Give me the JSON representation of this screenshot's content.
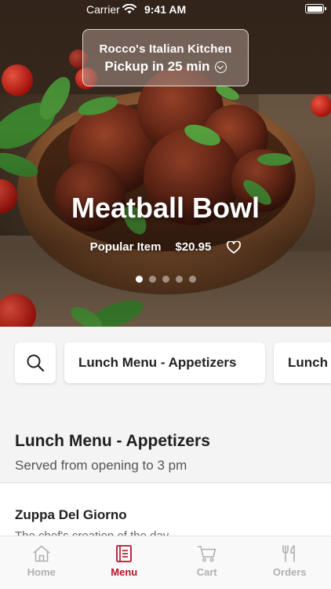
{
  "status_bar": {
    "carrier": "Carrier",
    "time": "9:41 AM"
  },
  "store": {
    "name": "Rocco's Italian Kitchen",
    "pickup": "Pickup in 25 min"
  },
  "featured": {
    "title": "Meatball Bowl",
    "tag": "Popular Item",
    "price": "$20.95",
    "slide_count": 5,
    "active_slide": 0
  },
  "categories": [
    "Lunch Menu - Appetizers",
    "Lunch"
  ],
  "section": {
    "title": "Lunch Menu - Appetizers",
    "subtitle": "Served from opening to 3 pm"
  },
  "items": [
    {
      "name": "Zuppa Del Giorno",
      "description": "The chef's creation of the day"
    }
  ],
  "tabs": [
    {
      "label": "Home",
      "icon": "home-icon",
      "active": false
    },
    {
      "label": "Menu",
      "icon": "menu-icon",
      "active": true
    },
    {
      "label": "Cart",
      "icon": "cart-icon",
      "active": false
    },
    {
      "label": "Orders",
      "icon": "orders-icon",
      "active": false
    }
  ],
  "colors": {
    "accent": "#b3142a",
    "tab_inactive": "#b0b0b0",
    "background": "#f4f4f4"
  }
}
